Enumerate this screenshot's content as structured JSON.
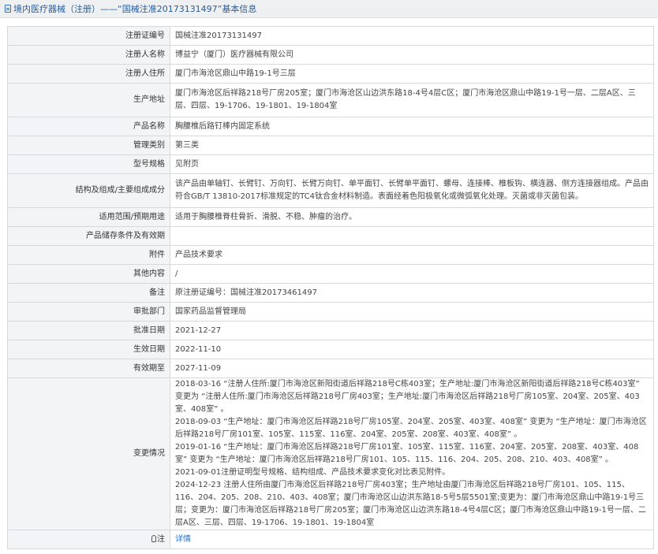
{
  "header": {
    "title": "境内医疗器械（注册）——“国械注准20173131497”基本信息"
  },
  "rows": {
    "reg_no": {
      "label": "注册证编号",
      "value": "国械注准20173131497"
    },
    "registrant": {
      "label": "注册人名称",
      "value": "博益宁（厦门）医疗器械有限公司"
    },
    "residence": {
      "label": "注册人住所",
      "value": "厦门市海沧区鼎山中路19-1号三层"
    },
    "production_address": {
      "label": "生产地址",
      "value": "厦门市海沧区后祥路218号厂房205室；厦门市海沧区山边洪东路18-4号4层C区；厦门市海沧区鼎山中路19-1号一层、二层A区、三层、四层、19-1706、19-1801、19-1804室"
    },
    "product_name": {
      "label": "产品名称",
      "value": "胸腰椎后路钉棒内固定系统"
    },
    "category": {
      "label": "管理类别",
      "value": "第三类"
    },
    "model": {
      "label": "型号规格",
      "value": "见附页"
    },
    "structure": {
      "label": "结构及组成/主要组成成分",
      "value": "该产品由单轴钉、长臂钉、万向钉、长臂万向钉、单平面钉、长臂单平面钉、螺母、连接棒、椎板钩、横连器、侧方连接器组成。产品由符合GB/T 13810-2017标准规定的TC4钛合金材料制造。表面经着色阳极氧化或微弧氧化处理。灭菌或非灭菌包装。"
    },
    "scope": {
      "label": "适用范围/预期用途",
      "value": "适用于胸腰椎脊柱骨折、滑脱、不稳、肿瘤的治疗。"
    },
    "storage": {
      "label": "产品储存条件及有效期",
      "value": ""
    },
    "attachment": {
      "label": "附件",
      "value": "产品技术要求"
    },
    "other": {
      "label": "其他内容",
      "value": "/"
    },
    "remark": {
      "label": "备注",
      "value": "原注册证编号：国械注准20173461497"
    },
    "dept": {
      "label": "审批部门",
      "value": "国家药品监督管理局"
    },
    "approval_date": {
      "label": "批准日期",
      "value": "2021-12-27"
    },
    "effective_date": {
      "label": "生效日期",
      "value": "2022-11-10"
    },
    "expiry_date": {
      "label": "有效期至",
      "value": "2027-11-09"
    },
    "changes": {
      "label": "变更情况",
      "lines": [
        "2018-03-16 “注册人住所:厦门市海沧区新阳街道后祥路218号C栋403室；生产地址:厦门市海沧区新阳街道后祥路218号C栋403室” 变更为 “注册人住所:厦门市海沧区后祥路218号厂房403室；生产地址:厦门市海沧区后祥路218号厂房105室、204室、205室、403室、408室” 。",
        "2018-09-03 “生产地址：厦门市海沧区后祥路218号厂房105室、204室、205室、403室、408室” 变更为 “生产地址：厦门市海沧区后祥路218号厂房101室、105室、115室、116室、204室、205室、208室、403室、408室” 。",
        "2019-01-16 “生产地址：厦门市海沧区后祥路218号厂房101室、105室、115室、116室、204室、205室、208室、403室、408室” 变更为 “生产地址：厦门市海沧区后祥路218号厂房101、105、115、116、204、205、208、210、403、408室” 。",
        "2021-09-01注册证明型号规格、结构组成、产品技术要求变化对比表见附件。",
        "2024-12-23 注册人住所由厦门市海沧区后祥路218号厂房403室；生产地址由厦门市海沧区后祥路218号厂房101、105、115、116、204、205、208、210、403、408室；厦门市海沧区山边洪东路18-5号5层5501室;变更为：厦门市海沧区鼎山中路19-1号三层；变更为：厦门市海沧区后祥路218号厂房205室；厦门市海沧区山边洪东路18-4号4层C区；厦门市海沧区鼎山中路19-1号一层、二层A区、三层、四层、19-1706、19-1801、19-1804室"
      ]
    },
    "note": {
      "label": "注",
      "value": "详情"
    }
  }
}
